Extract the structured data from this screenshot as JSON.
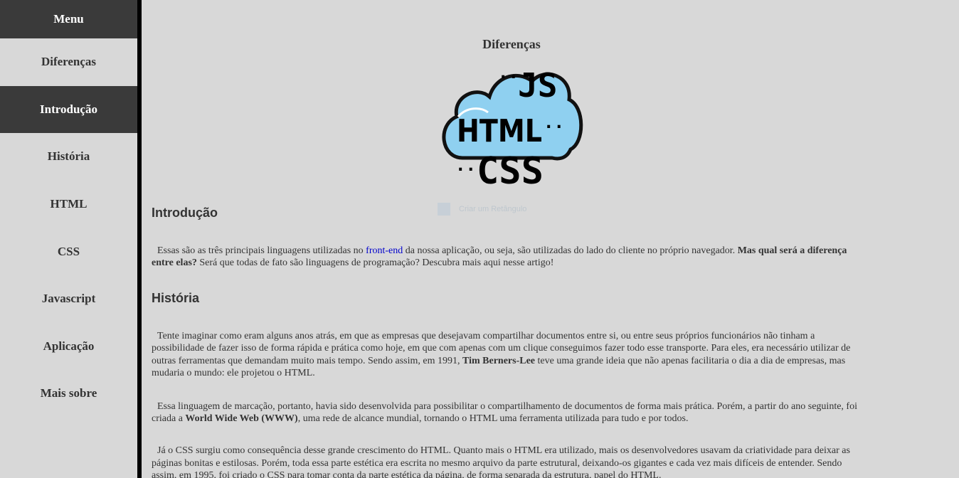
{
  "sidebar": {
    "menu_label": "Menu",
    "items": [
      {
        "label": "Diferenças"
      },
      {
        "label": "Introdução"
      },
      {
        "label": "História"
      },
      {
        "label": "HTML"
      },
      {
        "label": "CSS"
      },
      {
        "label": "Javascript"
      },
      {
        "label": "Aplicação"
      },
      {
        "label": "Mais sobre"
      }
    ],
    "active_index": 1
  },
  "main": {
    "title": "Diferenças",
    "logo": {
      "icon": "cloud-js-html-css-logo",
      "text_js": "JS",
      "text_html": "HTML",
      "text_css": "CSS",
      "cloud_color": "#8fd0f0"
    },
    "ghost_badge": "Criar um Retângulo",
    "intro": {
      "heading": "Introdução",
      "p1_a": "Essas são as três principais linguagens utilizadas no ",
      "p1_link": "front-end",
      "p1_b": " da nossa aplicação, ou seja, são utilizadas do lado do cliente no próprio navegador. ",
      "p1_bold": "Mas qual será a diferença entre elas?",
      "p1_c": " Será que todas de fato são linguagens de programação? Descubra mais aqui nesse artigo!"
    },
    "history": {
      "heading": "História",
      "p1_a": "Tente imaginar como eram alguns anos atrás, em que as empresas que desejavam compartilhar documentos entre si, ou entre seus próprios funcionários não tinham a possibilidade de fazer isso de forma rápida e prática como hoje, em que com apenas com um clique conseguimos fazer todo esse transporte. Para eles, era necessário utilizar de outras ferramentas que demandam muito mais tempo. Sendo assim, em 1991, ",
      "p1_bold": "Tim Berners-Lee",
      "p1_b": " teve uma grande ideia que não apenas facilitaria o dia a dia de empresas, mas mudaria o mundo: ele projetou o HTML.",
      "p2_a": "Essa linguagem de marcação, portanto, havia sido desenvolvida para possibilitar o compartilhamento de documentos de forma mais prática. Porém, a partir do ano seguinte, foi criada a ",
      "p2_bold": "World Wide Web (WWW)",
      "p2_b": ", uma rede de alcance mundial, tornando o HTML uma ferramenta utilizada para tudo e por todos.",
      "p3": "Já o CSS surgiu como consequência desse grande crescimento do HTML. Quanto mais o HTML era utilizado, mais os desenvolvedores usavam da criatividade para deixar as páginas bonitas e estilosas. Porém, toda essa parte estética era escrita no mesmo arquivo da parte estrutural, deixando-os gigantes e cada vez mais difíceis de entender. Sendo assim, em 1995, foi criado o CSS para tomar conta da parte estética da página, de forma separada da estrutura, papel do HTML."
    }
  }
}
